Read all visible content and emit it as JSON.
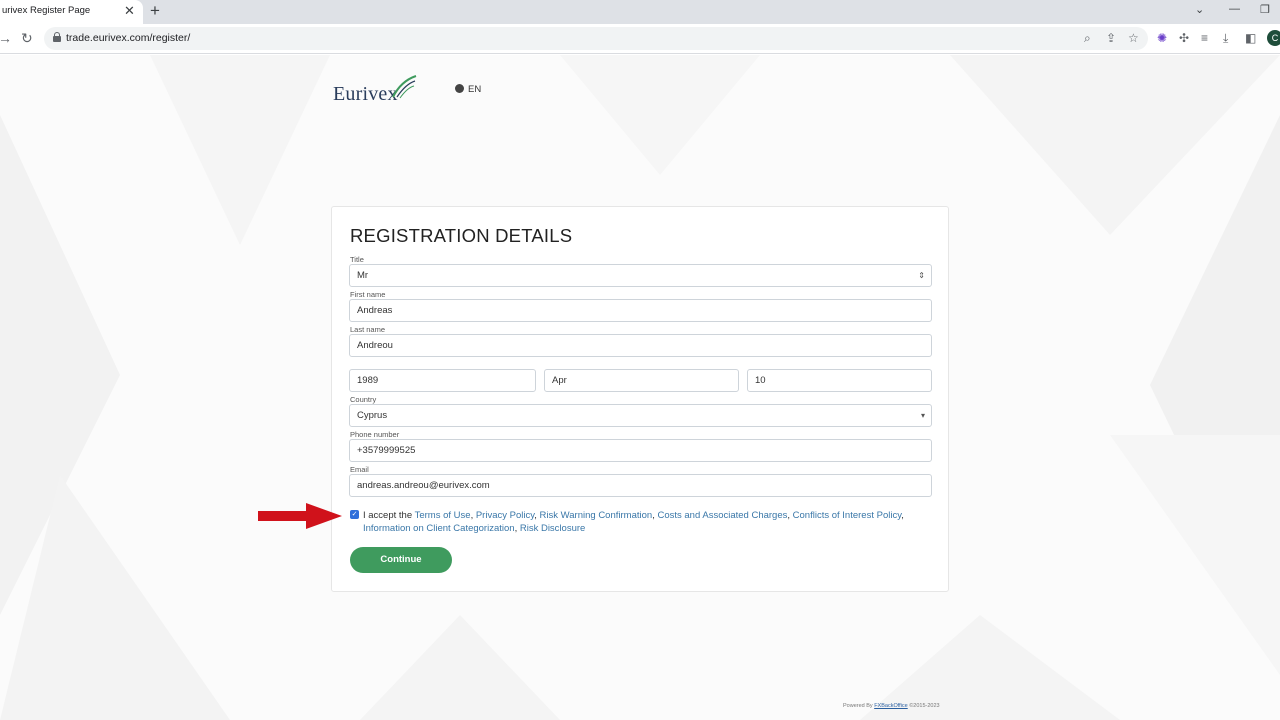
{
  "browser": {
    "tab_title": "urivex Register Page",
    "tab_close": "✕",
    "new_tab": "+",
    "url": "trade.eurivex.com/register/",
    "profile_initial": "C"
  },
  "header": {
    "logo_text": "Eurivex",
    "language": "EN"
  },
  "form": {
    "title": "REGISTRATION DETAILS",
    "fields": {
      "title": {
        "label": "Title",
        "value": "Mr"
      },
      "first_name": {
        "label": "First name",
        "value": "Andreas"
      },
      "last_name": {
        "label": "Last name",
        "value": "Andreou"
      },
      "dob_year": {
        "value": "1989"
      },
      "dob_month": {
        "value": "Apr"
      },
      "dob_day": {
        "value": "10"
      },
      "country": {
        "label": "Country",
        "value": "Cyprus"
      },
      "phone": {
        "label": "Phone number",
        "value": "+3579999525"
      },
      "email": {
        "label": "Email",
        "value": "andreas.andreou@eurivex.com"
      }
    },
    "terms": {
      "checked": true,
      "prefix": "I accept the ",
      "links": [
        "Terms of Use",
        "Privacy Policy",
        "Risk Warning Confirmation",
        "Costs and Associated Charges",
        "Conflicts of Interest Policy",
        "Information on Client Categorization",
        "Risk Disclosure"
      ]
    },
    "continue_label": "Continue"
  },
  "footer": {
    "powered_by": "Powered By ",
    "brand": "FXBackOffice",
    "copyright": " ©2015-2023"
  },
  "colors": {
    "accent_green": "#3f9b5e",
    "link_blue": "#3a77a8",
    "arrow_red": "#d0121b",
    "logo_navy": "#2a3d5c"
  }
}
